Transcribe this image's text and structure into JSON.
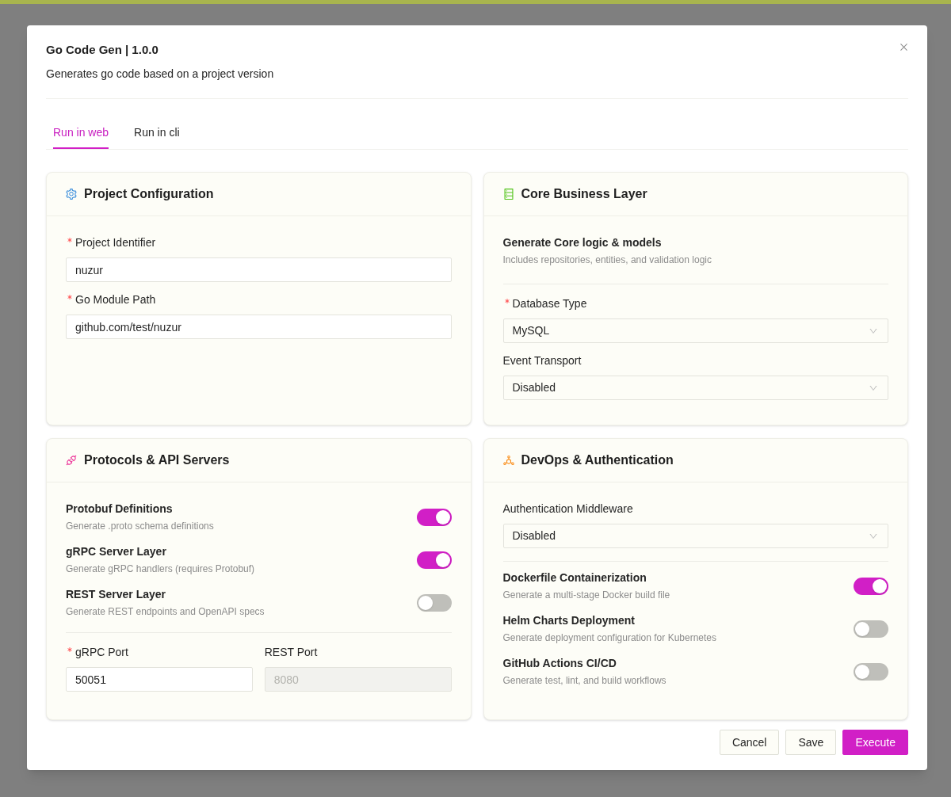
{
  "dialog": {
    "title": "Go Code Gen | 1.0.0",
    "subtitle": "Generates go code based on a project version"
  },
  "tabs": [
    {
      "label": "Run in web",
      "selected": true
    },
    {
      "label": "Run in cli",
      "selected": false
    }
  ],
  "cards": [
    {
      "title": "Project Configuration",
      "items": [
        {
          "kind": "input",
          "label": "Project Identifier",
          "required": true,
          "value": "nuzur"
        },
        {
          "kind": "input",
          "label": "Go Module Path",
          "required": true,
          "value": "github.com/test/nuzur"
        }
      ]
    },
    {
      "title": "Core Business Layer",
      "items": [
        {
          "kind": "heading",
          "title": "Generate Core logic & models",
          "description": "Includes repositories, entities, and validation logic"
        },
        {
          "kind": "divider"
        },
        {
          "kind": "select",
          "label": "Database Type",
          "required": true,
          "value": "MySQL"
        },
        {
          "kind": "select",
          "label": "Event Transport",
          "required": false,
          "value": "Disabled"
        }
      ]
    },
    {
      "title": "Protocols & API Servers",
      "items": [
        {
          "kind": "toggle",
          "title": "Protobuf Definitions",
          "description": "Generate .proto schema definitions",
          "on": true
        },
        {
          "kind": "toggle",
          "title": "gRPC Server Layer",
          "description": "Generate gRPC handlers (requires Protobuf)",
          "on": true
        },
        {
          "kind": "toggle",
          "title": "REST Server Layer",
          "description": "Generate REST endpoints and OpenAPI specs",
          "on": false
        },
        {
          "kind": "divider"
        },
        {
          "kind": "input-row",
          "fields": [
            {
              "label": "gRPC Port",
              "required": true,
              "value": "50051",
              "disabled": false
            },
            {
              "label": "REST Port",
              "required": false,
              "value": "8080",
              "disabled": true
            }
          ]
        }
      ]
    },
    {
      "title": "DevOps & Authentication",
      "items": [
        {
          "kind": "select",
          "label": "Authentication Middleware",
          "required": false,
          "value": "Disabled"
        },
        {
          "kind": "divider"
        },
        {
          "kind": "toggle",
          "title": "Dockerfile Containerization",
          "description": "Generate a multi-stage Docker build file",
          "on": true
        },
        {
          "kind": "toggle",
          "title": "Helm Charts Deployment",
          "description": "Generate deployment configuration for Kubernetes",
          "on": false
        },
        {
          "kind": "toggle",
          "title": "GitHub Actions CI/CD",
          "description": "Generate test, lint, and build workflows",
          "on": false
        }
      ]
    }
  ],
  "buttons": [
    {
      "label": "Cancel",
      "kind": "default"
    },
    {
      "label": "Save",
      "kind": "default"
    },
    {
      "label": "Execute",
      "kind": "primary"
    }
  ]
}
